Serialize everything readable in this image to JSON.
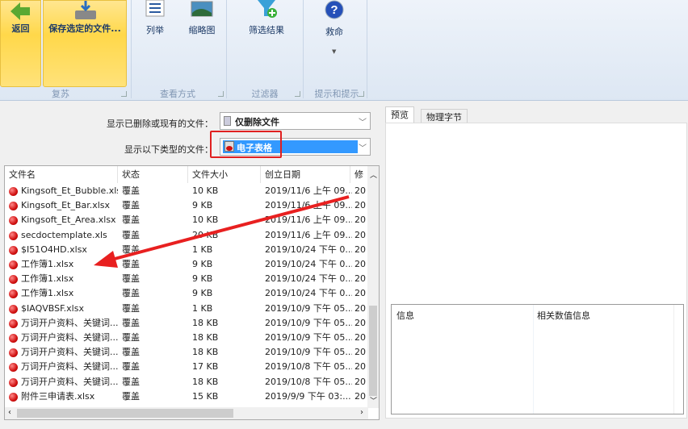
{
  "ribbon": {
    "back_label": "返回",
    "save_label": "保存选定的文件...",
    "list_label": "列举",
    "thumb_label": "缩略图",
    "filter_label": "筛选结果",
    "help_label": "救命",
    "groups": [
      "复苏",
      "查看方式",
      "过滤器",
      "提示和提示"
    ]
  },
  "filters": {
    "deleted_label": "显示已删除或现有的文件：",
    "deleted_value": "仅删除文件",
    "type_label": "显示以下类型的文件：",
    "type_value": "电子表格"
  },
  "table": {
    "columns": [
      "文件名",
      "状态",
      "文件大小",
      "创立日期",
      "修"
    ],
    "rows": [
      {
        "name": "Kingsoft_Et_Bubble.xlsx",
        "status": "覆盖",
        "size": "10 KB",
        "created": "2019/11/6 上午 09...",
        "mod": "20"
      },
      {
        "name": "Kingsoft_Et_Bar.xlsx",
        "status": "覆盖",
        "size": "9 KB",
        "created": "2019/11/6 上午 09...",
        "mod": "20"
      },
      {
        "name": "Kingsoft_Et_Area.xlsx",
        "status": "覆盖",
        "size": "10 KB",
        "created": "2019/11/6 上午 09...",
        "mod": "20"
      },
      {
        "name": "secdoctemplate.xls",
        "status": "覆盖",
        "size": "20 KB",
        "created": "2019/11/6 上午 09...",
        "mod": "20"
      },
      {
        "name": "$I51O4HD.xlsx",
        "status": "覆盖",
        "size": "1 KB",
        "created": "2019/10/24 下午 0...",
        "mod": "20"
      },
      {
        "name": "工作簿1.xlsx",
        "status": "覆盖",
        "size": "9 KB",
        "created": "2019/10/24 下午 0...",
        "mod": "20"
      },
      {
        "name": "工作簿1.xlsx",
        "status": "覆盖",
        "size": "9 KB",
        "created": "2019/10/24 下午 0...",
        "mod": "20"
      },
      {
        "name": "工作簿1.xlsx",
        "status": "覆盖",
        "size": "9 KB",
        "created": "2019/10/24 下午 0...",
        "mod": "20"
      },
      {
        "name": "$IAQVBSF.xlsx",
        "status": "覆盖",
        "size": "1 KB",
        "created": "2019/10/9 下午 05...",
        "mod": "20"
      },
      {
        "name": "万词开户资料、关键词...",
        "status": "覆盖",
        "size": "18 KB",
        "created": "2019/10/9 下午 05...",
        "mod": "20"
      },
      {
        "name": "万词开户资料、关键词...",
        "status": "覆盖",
        "size": "18 KB",
        "created": "2019/10/9 下午 05...",
        "mod": "20"
      },
      {
        "name": "万词开户资料、关键词...",
        "status": "覆盖",
        "size": "18 KB",
        "created": "2019/10/9 下午 05...",
        "mod": "20"
      },
      {
        "name": "万词开户资料、关键词...",
        "status": "覆盖",
        "size": "17 KB",
        "created": "2019/10/8 下午 05...",
        "mod": "20"
      },
      {
        "name": "万词开户资料、关键词...",
        "status": "覆盖",
        "size": "18 KB",
        "created": "2019/10/8 下午 05...",
        "mod": "20"
      },
      {
        "name": "附件三申请表.xlsx",
        "status": "覆盖",
        "size": "15 KB",
        "created": "2019/9/9 下午 03:...",
        "mod": "20"
      }
    ]
  },
  "preview": {
    "tabs": [
      "预览",
      "物理字节"
    ],
    "info_columns": [
      "信息",
      "相关数值信息"
    ]
  },
  "colors": {
    "highlight": "#e02020",
    "selection": "#3399ff"
  }
}
